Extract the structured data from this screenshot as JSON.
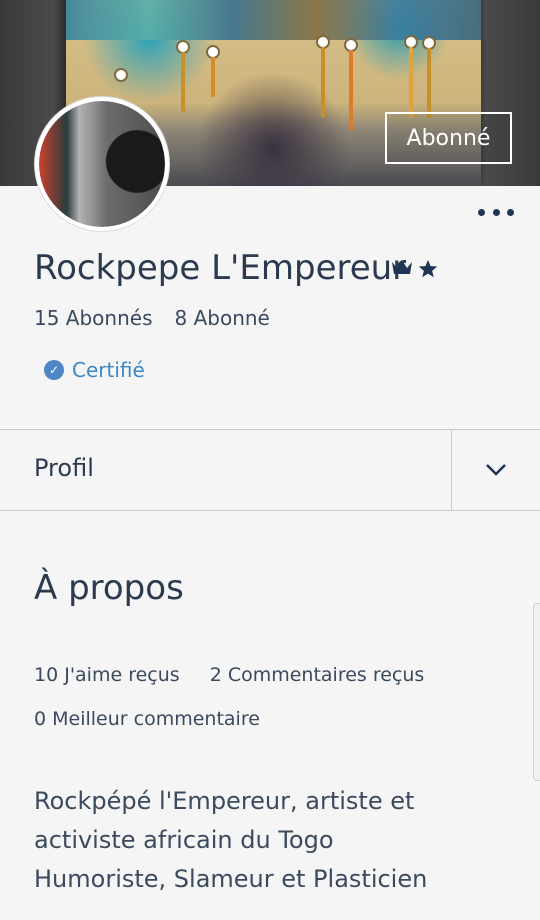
{
  "profile": {
    "name": "Rockpepe L'Empereur",
    "follow_button": "Abonné",
    "followers": "15 Abonnés",
    "following": "8 Abonné",
    "certified": "Certifié",
    "icons": [
      "crown-icon",
      "star-icon",
      "more-icon",
      "check-icon",
      "chevron-down-icon"
    ]
  },
  "tabs": {
    "current": "Profil"
  },
  "about": {
    "title": "À propos",
    "likes": "10 J'aime reçus",
    "comments": "2 Commentaires reçus",
    "best_comment": "0 Meilleur commentaire",
    "bio": [
      "Rockpépé l'Empereur, artiste et",
      "activiste africain du Togo",
      "Humoriste, Slameur et Plasticien"
    ]
  },
  "colors": {
    "text": "#2b3a4f",
    "accent": "#3c87c4",
    "badge": "#4f86c6"
  }
}
